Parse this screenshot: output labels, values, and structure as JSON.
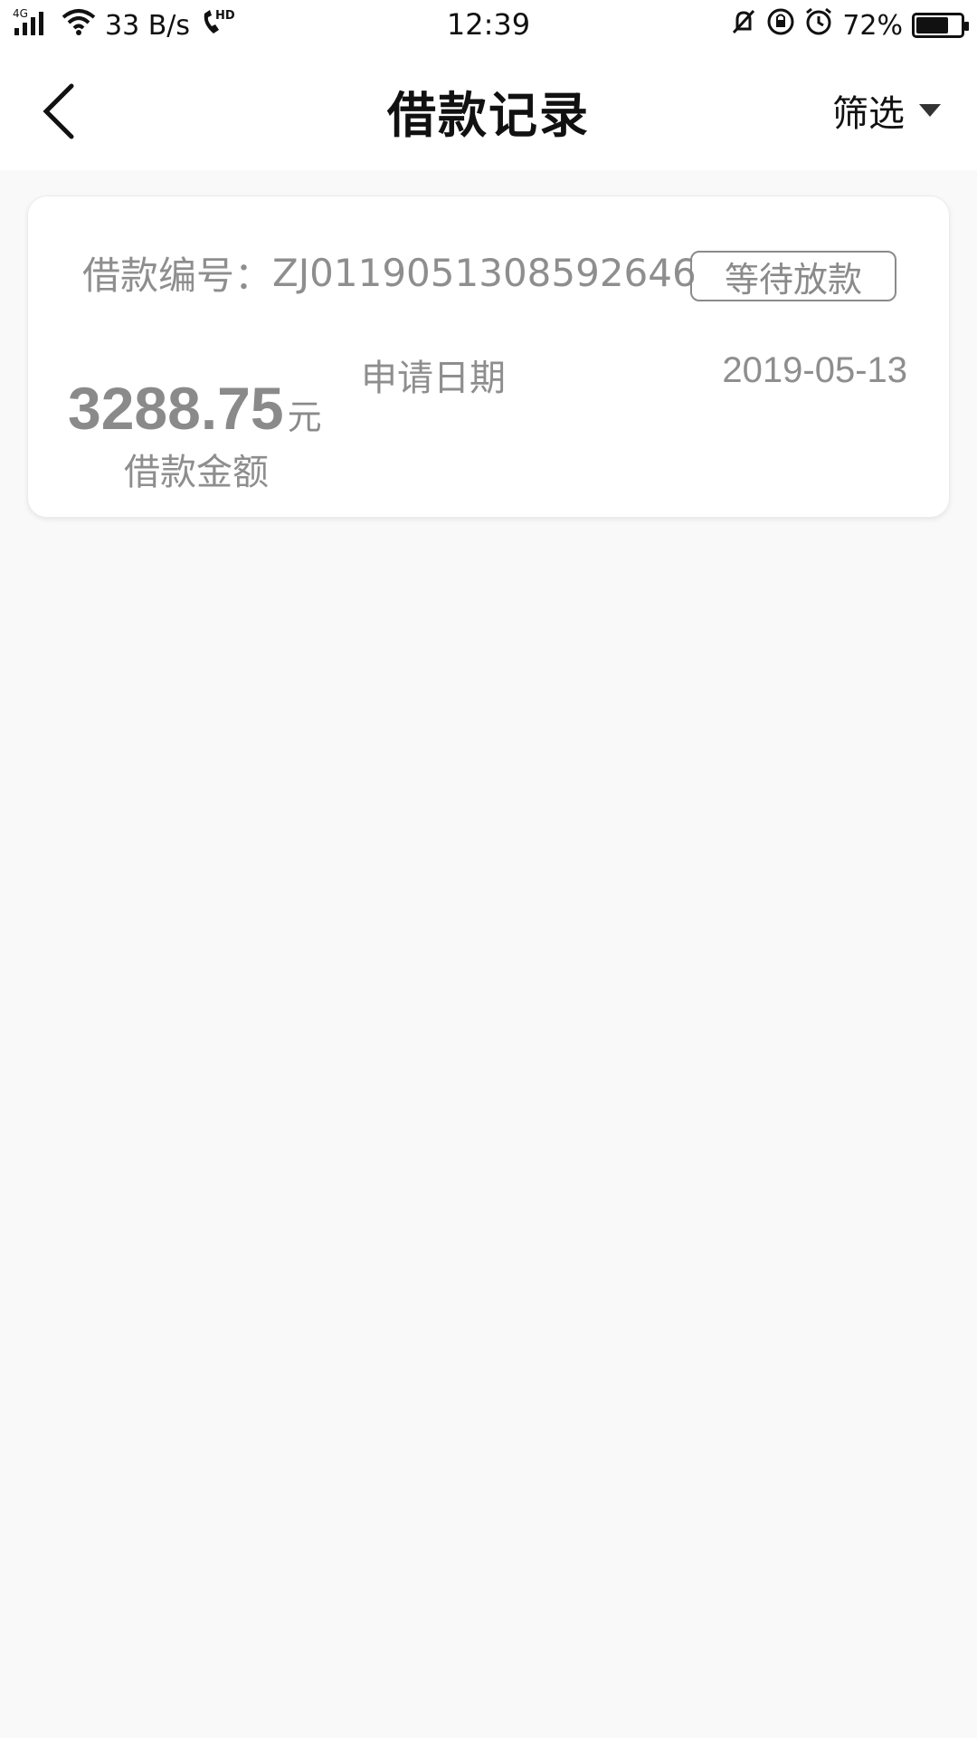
{
  "status_bar": {
    "network": "4G",
    "net_speed": "33 B/s",
    "call_tag": "HD",
    "time": "12:39",
    "battery_percent": "72%",
    "battery_level": 0.72
  },
  "header": {
    "title": "借款记录",
    "filter_label": "筛选"
  },
  "record": {
    "loan_no_label": "借款编号：",
    "loan_no": "ZJ0119051308592646",
    "status": "等待放款",
    "amount": "3288.75",
    "amount_unit": "元",
    "amount_label": "借款金额",
    "apply_date_label": "申请日期",
    "apply_date": "2019-05-13"
  }
}
